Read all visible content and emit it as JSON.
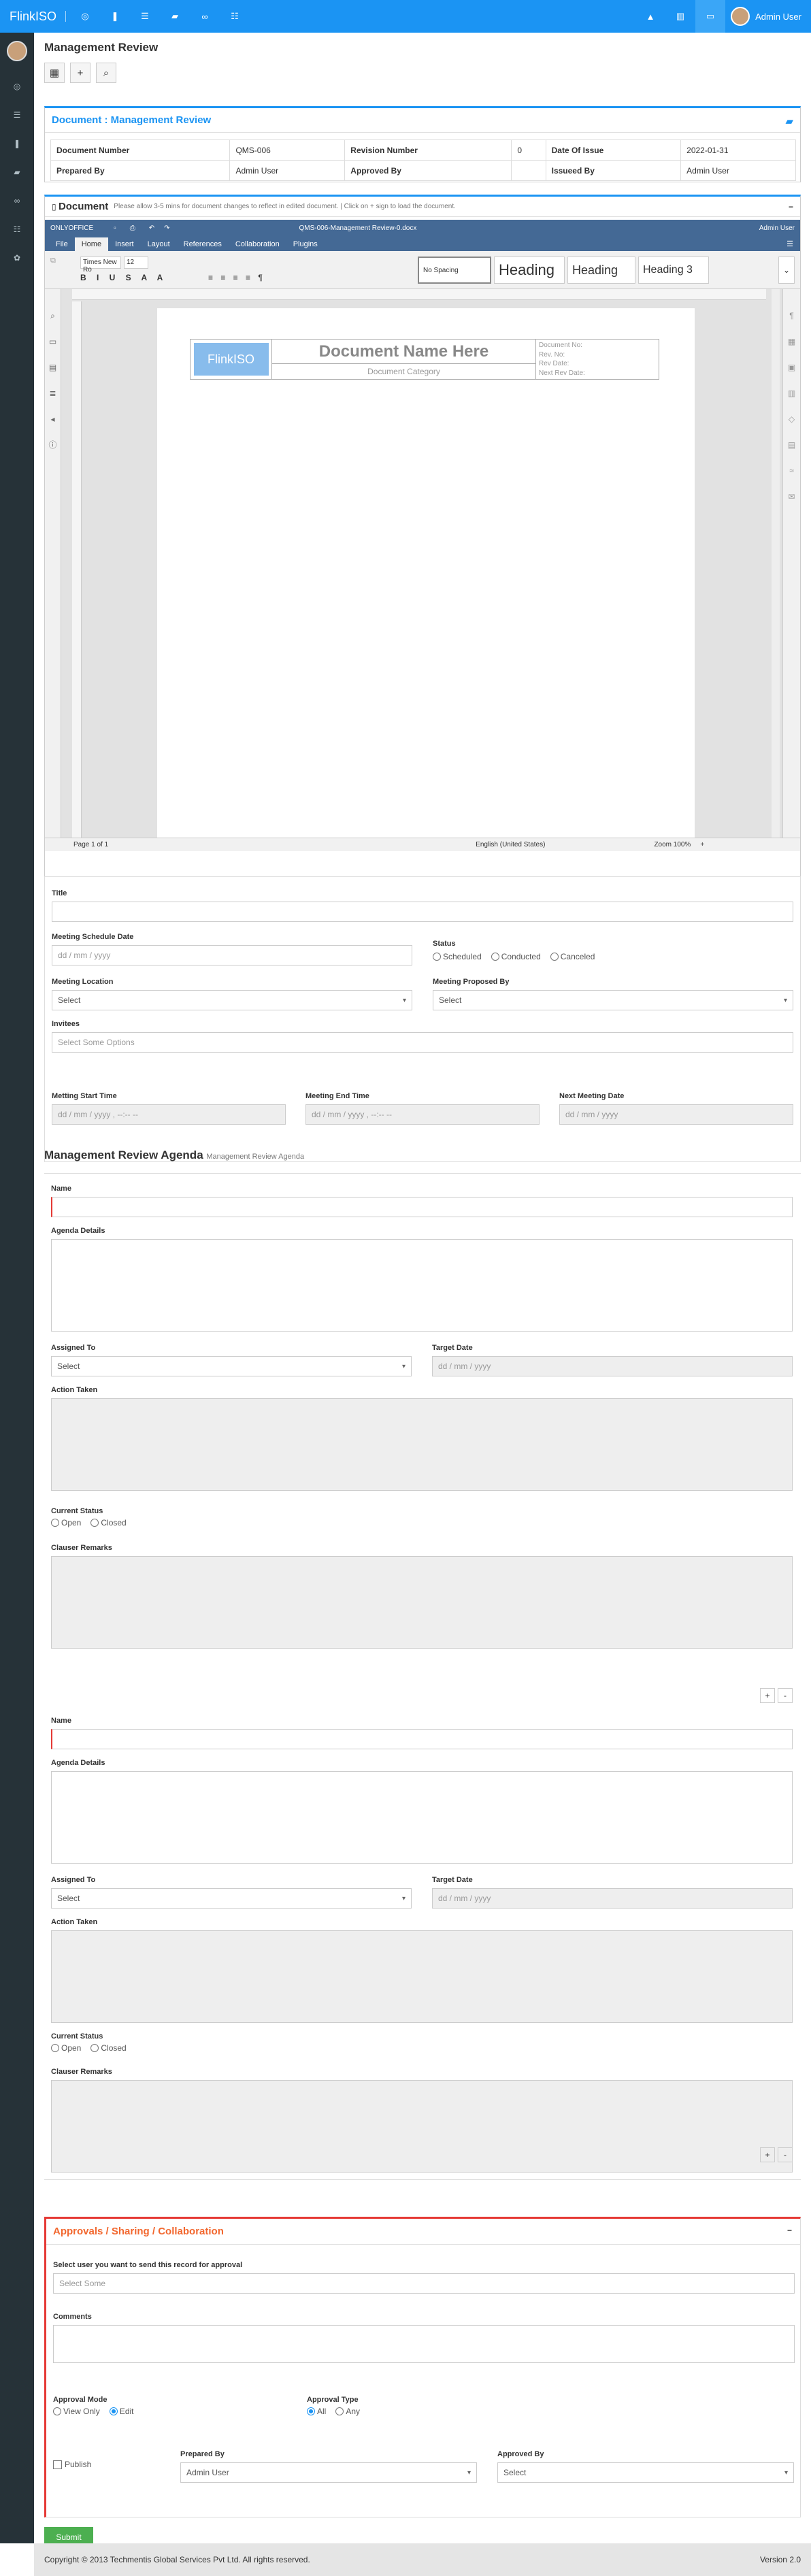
{
  "app": {
    "brand": "FlinkISO",
    "user": "Admin User"
  },
  "page": {
    "title": "Management Review"
  },
  "doc_info": {
    "heading": "Document : Management Review",
    "row1": [
      "Document Number",
      "QMS-006",
      "Revision Number",
      "0",
      "Date Of Issue",
      "2022-01-31"
    ],
    "row2": [
      "Prepared By",
      "Admin User",
      "Approved By",
      "",
      "Issueed By",
      "Admin User"
    ]
  },
  "document": {
    "title": "Document",
    "note": "Please allow 3-5 mins for document changes to reflect in edited document. | Click on + sign to load the document.",
    "oo_brand": "ONLYOFFICE",
    "file": "QMS-006-Management Review-0.docx",
    "oo_user": "Admin User",
    "menu": [
      "File",
      "Home",
      "Insert",
      "Layout",
      "References",
      "Collaboration",
      "Plugins"
    ],
    "font": "Times New Ro",
    "size": "12",
    "styles": [
      "No Spacing",
      "Heading",
      "Heading",
      "Heading 3"
    ],
    "logo": "FlinkISO",
    "doc_name": "Document Name Here",
    "doc_cat": "Document Category",
    "meta": [
      "Document No:",
      "Rev. No:",
      "Rev Date:",
      "Next Rev Date:"
    ],
    "page_of": "Page 1 of 1",
    "lang": "English (United States)",
    "zoom": "Zoom 100%"
  },
  "form": {
    "title": "Title",
    "meeting_date": "Meeting Schedule Date",
    "date_ph": "dd / mm / yyyy",
    "status": "Status",
    "status_opts": [
      "Scheduled",
      "Conducted",
      "Canceled"
    ],
    "location": "Meeting Location",
    "proposed": "Meeting Proposed By",
    "select": "Select",
    "invitees": "Invitees",
    "invitees_ph": "Select Some Options",
    "start": "Metting Start Time",
    "end": "Meeting End Time",
    "next": "Next Meeting Date",
    "dt_ph": "dd / mm / yyyy , --:-- --"
  },
  "agenda": {
    "heading": "Management Review Agenda",
    "sub": "Management Review Agenda",
    "name": "Name",
    "details": "Agenda Details",
    "assigned": "Assigned To",
    "target": "Target Date",
    "action": "Action Taken",
    "cur_status": "Current Status",
    "status_opts": [
      "Open",
      "Closed"
    ],
    "remarks": "Clauser Remarks"
  },
  "approvals": {
    "heading": "Approvals / Sharing / Collaboration",
    "select_user": "Select user you want to send this record for approval",
    "select_some": "Select Some",
    "comments": "Comments",
    "mode": "Approval Mode",
    "mode_opts": [
      "View Only",
      "Edit"
    ],
    "type": "Approval Type",
    "type_opts": [
      "All",
      "Any"
    ],
    "publish": "Publish",
    "prepared": "Prepared By",
    "prepared_val": "Admin User",
    "approved": "Approved By",
    "approved_val": "Select",
    "submit": "Submit"
  },
  "footer": {
    "copy": "Copyright © 2013 Techmentis Global Services Pvt Ltd. All rights reserved.",
    "version": "Version 2.0"
  }
}
